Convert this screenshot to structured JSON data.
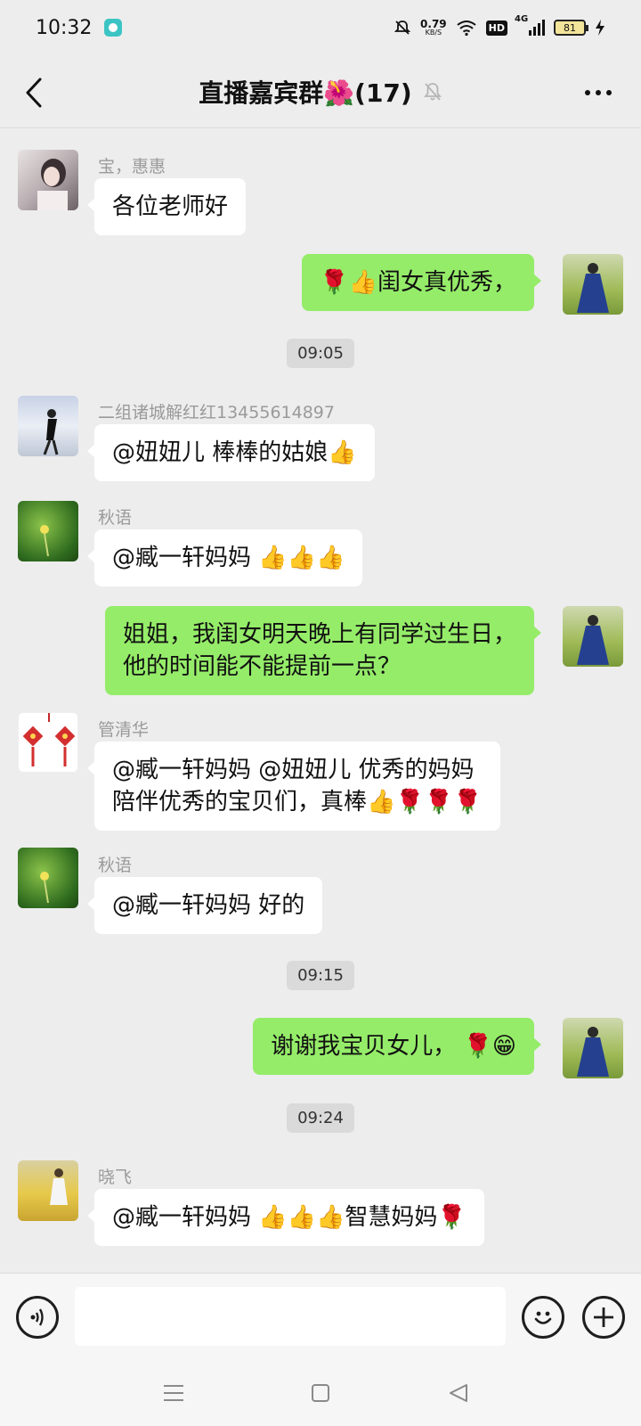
{
  "status_bar": {
    "time": "10:32",
    "net_speed_value": "0.79",
    "net_speed_unit": "KB/S",
    "hd": "HD",
    "network": "4G",
    "battery": "81"
  },
  "header": {
    "title": "直播嘉宾群🌺(17)",
    "icons": [
      "back-icon",
      "mute-bell-icon",
      "more-icon"
    ]
  },
  "messages": [
    {
      "side": "left",
      "sender": "宝，惠惠",
      "text": "各位老师好"
    },
    {
      "side": "right",
      "text": "🌹👍闺女真优秀，"
    },
    {
      "time": "09:05"
    },
    {
      "side": "left",
      "sender": "二组诸城解红红13455614897",
      "text": "@妞妞儿  棒棒的姑娘👍"
    },
    {
      "side": "left",
      "sender": "秋语",
      "text": "@臧一轩妈妈  👍👍👍"
    },
    {
      "side": "right",
      "text_lines": [
        "姐姐，我闺女明天晚上有同学过生日，",
        "他的时间能不能提前一点？"
      ]
    },
    {
      "side": "left",
      "sender": "管清华",
      "text_lines": [
        "@臧一轩妈妈  @妞妞儿  优秀的妈妈",
        "陪伴优秀的宝贝们，真棒👍🌹🌹🌹"
      ]
    },
    {
      "side": "left",
      "sender": "秋语",
      "text": "@臧一轩妈妈  好的"
    },
    {
      "time": "09:15"
    },
    {
      "side": "right",
      "text": "谢谢我宝贝女儿， 🌹😁"
    },
    {
      "time": "09:24"
    },
    {
      "side": "left",
      "sender": "晓飞",
      "text": "@臧一轩妈妈  👍👍👍智慧妈妈🌹"
    }
  ],
  "input_bar": {
    "placeholder": "",
    "icons": [
      "voice-icon",
      "emoji-icon",
      "plus-icon"
    ]
  },
  "nav_bar": {
    "icons": [
      "menu-icon",
      "home-icon",
      "back-triangle-icon"
    ]
  },
  "colors": {
    "background": "#ededed",
    "my_bubble": "#95ec69",
    "other_bubble": "#ffffff"
  }
}
